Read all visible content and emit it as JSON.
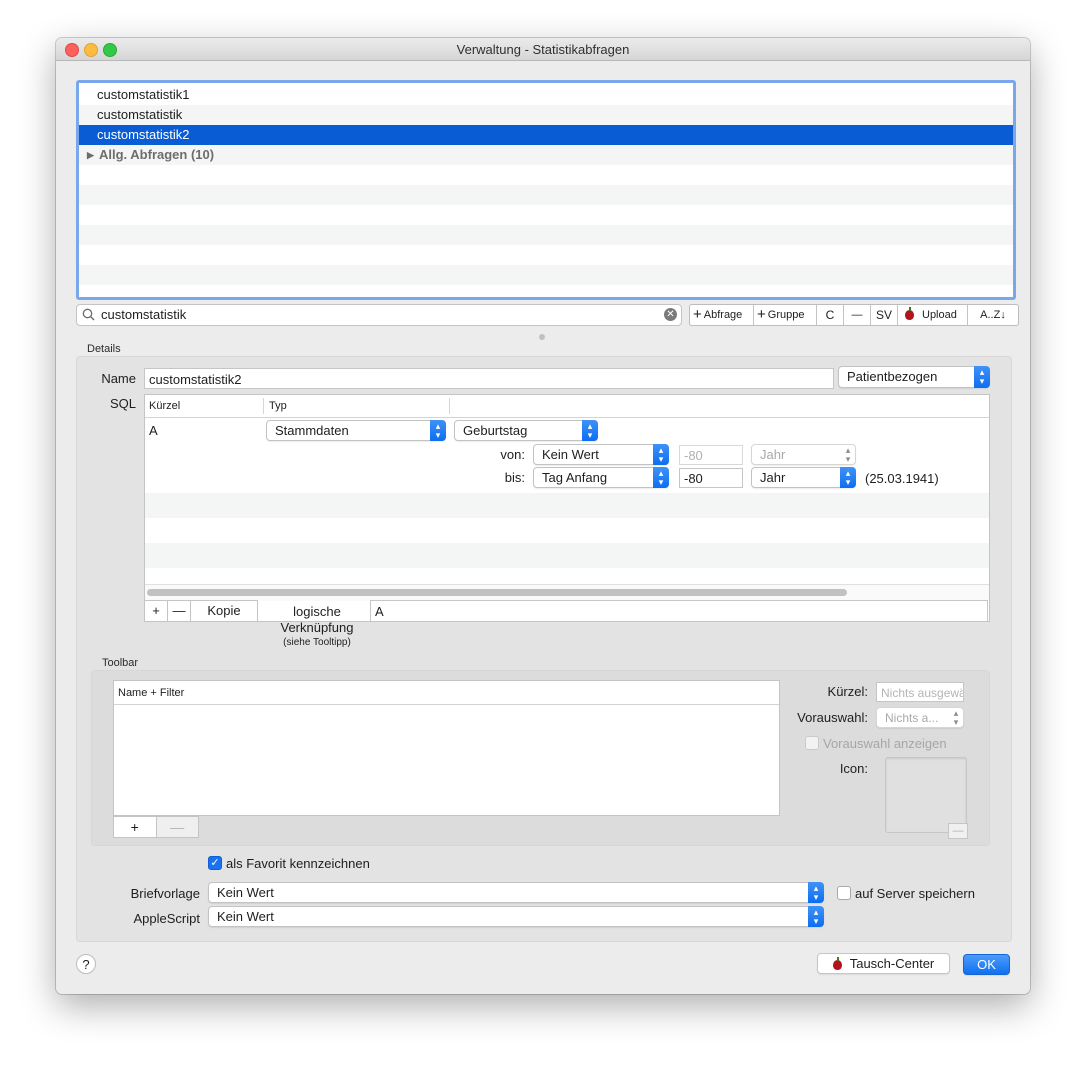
{
  "window": {
    "title": "Verwaltung - Statistikabfragen"
  },
  "list": {
    "items": [
      "customstatistik1",
      "customstatistik",
      "customstatistik2"
    ],
    "group_label": "Allg. Abfragen (10)"
  },
  "search": {
    "value": "customstatistik"
  },
  "toolbar_buttons": {
    "add_query": "Abfrage",
    "add_group": "Gruppe",
    "c": "C",
    "minus": "—",
    "sv": "SV",
    "upload": "Upload",
    "sort": "A..Z↓"
  },
  "details": {
    "section_label": "Details",
    "name_label": "Name",
    "name_value": "customstatistik2",
    "scope_popup": "Patientbezogen",
    "sql_label": "SQL",
    "sql_table": {
      "col_kuerzel": "Kürzel",
      "col_typ": "Typ",
      "row_kuerzel": "A",
      "typ_popup": "Stammdaten",
      "field_popup": "Geburtstag",
      "von_label": "von:",
      "von_popup": "Kein Wert",
      "von_number": "-80",
      "von_unit": "Jahr",
      "bis_label": "bis:",
      "bis_popup": "Tag Anfang",
      "bis_number": "-80",
      "bis_unit": "Jahr",
      "bis_result": "(25.03.1941)"
    },
    "footer": {
      "add": "+",
      "remove": "—",
      "copy": "Kopie"
    },
    "logic_label_1": "logische",
    "logic_label_2": "Verknüpfung",
    "logic_hint": "(siehe Tooltipp)",
    "logic_value": "A"
  },
  "toolbar_section": {
    "section_label": "Toolbar",
    "table_header": "Name + Filter",
    "add": "+",
    "remove": "—",
    "kuerzel_label": "Kürzel:",
    "kuerzel_placeholder": "Nichts ausgewählt",
    "vorauswahl_label": "Vorauswahl:",
    "vorauswahl_popup": "Nichts a...",
    "vorauswahl_anzeigen": "Vorauswahl anzeigen",
    "icon_label": "Icon:",
    "icon_remove": "—"
  },
  "options": {
    "favorite": "als Favorit kennzeichnen",
    "briefvorlage_label": "Briefvorlage",
    "briefvorlage_value": "Kein Wert",
    "server_save": "auf Server speichern",
    "applescript_label": "AppleScript",
    "applescript_value": "Kein Wert"
  },
  "bottom": {
    "help": "?",
    "tausch_center": "Tausch-Center",
    "ok": "OK"
  },
  "colors": {
    "accent": "#0a5cd4",
    "focus_ring": "#79a8ea"
  }
}
